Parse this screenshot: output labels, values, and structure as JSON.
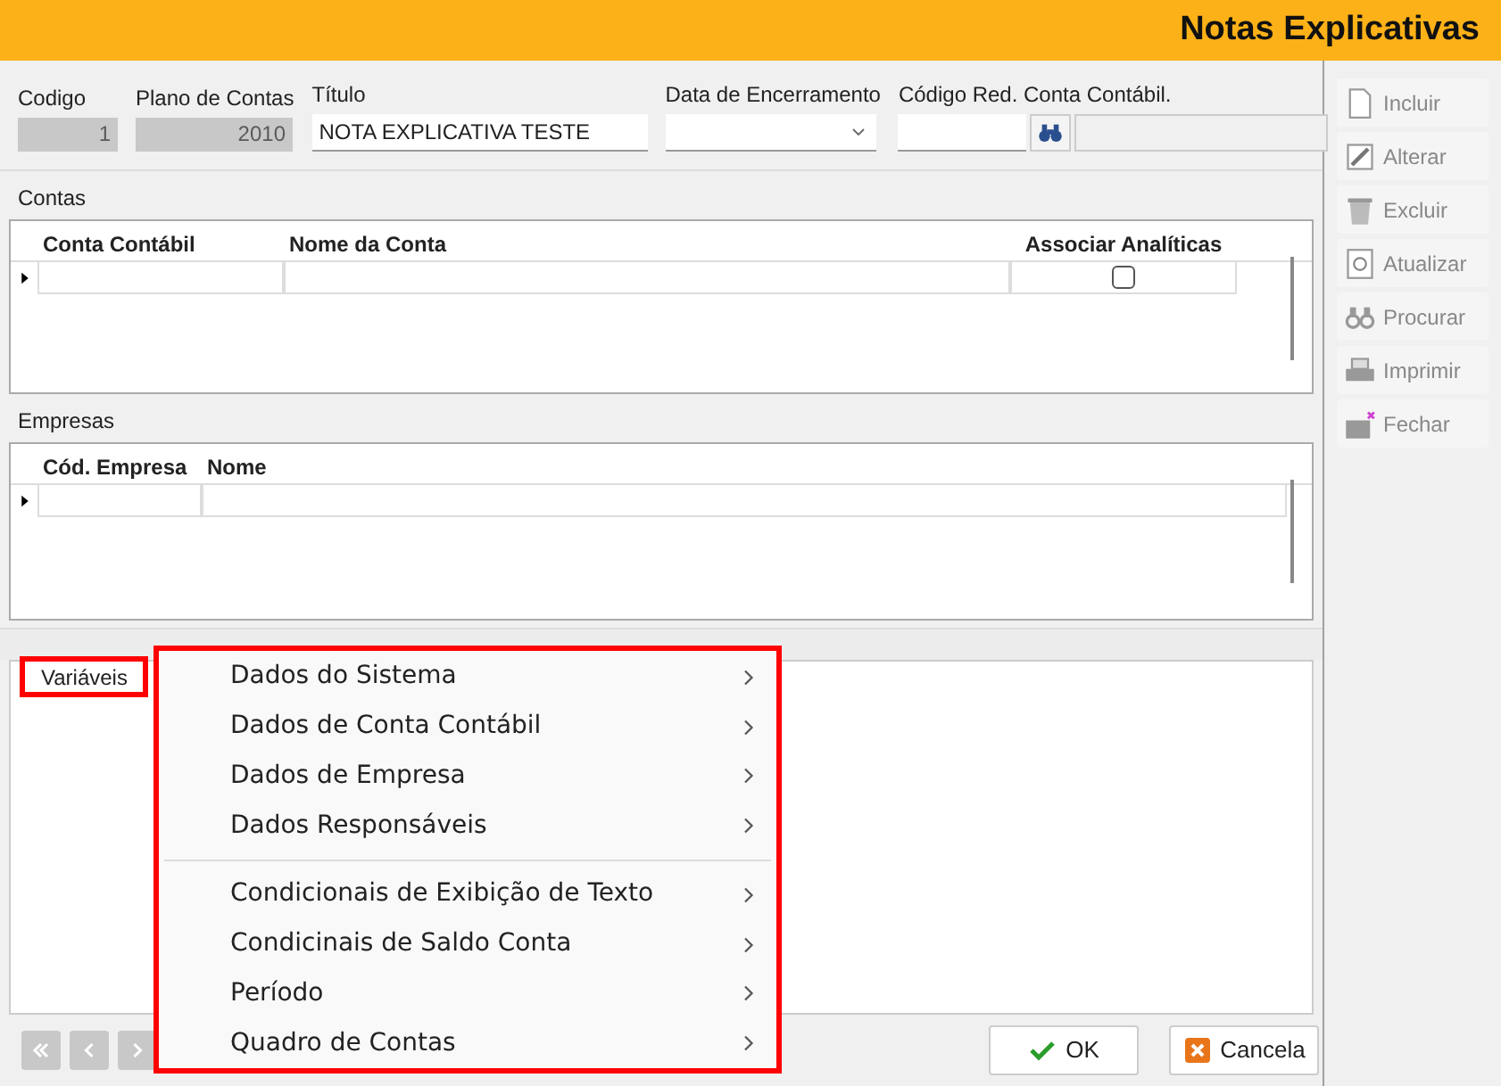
{
  "window": {
    "title": "Notas Explicativas"
  },
  "header_fields": [
    {
      "label": "Codigo",
      "value": "1",
      "kind": "readonly"
    },
    {
      "label": "Plano de Contas",
      "value": "2010",
      "kind": "readonly"
    },
    {
      "label": "Título",
      "value": "NOTA EXPLICATIVA TESTE",
      "kind": "text"
    },
    {
      "label": "Data de Encerramento",
      "kind": "dropdown"
    },
    {
      "label": "Código Red. Conta Contábil.",
      "kind": "lookup"
    }
  ],
  "contas": {
    "title": "Contas",
    "columns": [
      "Conta Contábil",
      "Nome da Conta",
      "Associar Analíticas"
    ],
    "rows": [
      {
        "conta": "",
        "nome": "",
        "associar_checked": false
      }
    ]
  },
  "empresas": {
    "title": "Empresas",
    "columns": [
      "Cód. Empresa",
      "Nome"
    ],
    "rows": [
      {
        "codigo": "",
        "nome": ""
      }
    ]
  },
  "tab": {
    "label": "Variáveis",
    "selected": true
  },
  "menu": [
    {
      "label": "Dados do Sistema",
      "kind": "submenu"
    },
    {
      "label": "Dados de Conta Contábil",
      "kind": "submenu"
    },
    {
      "label": "Dados de Empresa",
      "kind": "submenu"
    },
    {
      "label": "Dados Responsáveis",
      "kind": "submenu"
    },
    {
      "kind": "separator"
    },
    {
      "label": "Condicionais de Exibição de Texto",
      "kind": "submenu"
    },
    {
      "label": "Condicinais de Saldo Conta",
      "kind": "submenu"
    },
    {
      "label": "Período",
      "kind": "submenu"
    },
    {
      "label": "Quadro de Contas",
      "kind": "submenu"
    }
  ],
  "toolbar": [
    {
      "label": "Incluir",
      "kind": "document",
      "disabled": true
    },
    {
      "label": "Alterar",
      "kind": "pencil",
      "disabled": true
    },
    {
      "label": "Excluir",
      "kind": "trash",
      "disabled": true
    },
    {
      "label": "Atualizar",
      "kind": "refresh",
      "disabled": true
    },
    {
      "label": "Procurar",
      "kind": "binoculars",
      "disabled": true
    },
    {
      "label": "Imprimir",
      "kind": "printer",
      "disabled": true
    },
    {
      "label": "Fechar",
      "kind": "exit",
      "disabled": true
    }
  ],
  "nav_buttons": [
    {
      "kind": "first"
    },
    {
      "kind": "prev"
    },
    {
      "kind": "next"
    }
  ],
  "dialog_buttons": [
    {
      "label": "OK",
      "kind": "ok"
    },
    {
      "label": "Cancela",
      "kind": "cancel"
    }
  ]
}
